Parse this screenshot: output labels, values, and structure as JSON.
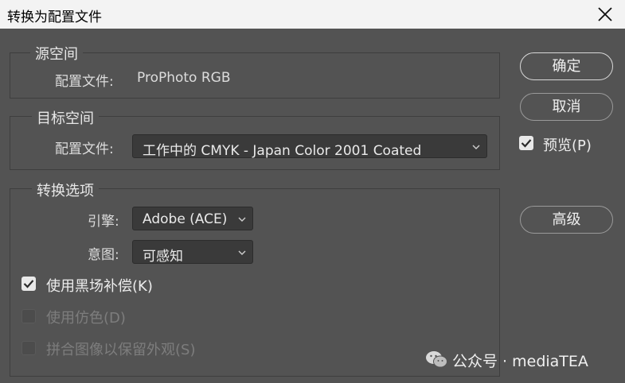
{
  "window": {
    "title": "转换为配置文件"
  },
  "source_space": {
    "legend": "源空间",
    "profile_label": "配置文件:",
    "profile_value": "ProPhoto RGB"
  },
  "destination_space": {
    "legend": "目标空间",
    "profile_label": "配置文件:",
    "profile_selected": "工作中的 CMYK - Japan Color 2001 Coated"
  },
  "conversion_options": {
    "legend": "转换选项",
    "engine_label": "引擎:",
    "engine_selected": "Adobe (ACE)",
    "intent_label": "意图:",
    "intent_selected": "可感知",
    "black_point": {
      "label": "使用黑场补偿(K)",
      "checked": true,
      "enabled": true
    },
    "dither": {
      "label": "使用仿色(D)",
      "checked": false,
      "enabled": false
    },
    "flatten": {
      "label": "拼合图像以保留外观(S)",
      "checked": false,
      "enabled": false
    }
  },
  "buttons": {
    "ok": "确定",
    "cancel": "取消",
    "advanced": "高级"
  },
  "preview": {
    "label": "预览(P)",
    "checked": true
  },
  "watermark": {
    "text": "公众号 · mediaTEA"
  },
  "colors": {
    "dialog_bg": "#535353",
    "titlebar_bg": "#f3f3f3",
    "field_bg": "#3a3a3a"
  }
}
